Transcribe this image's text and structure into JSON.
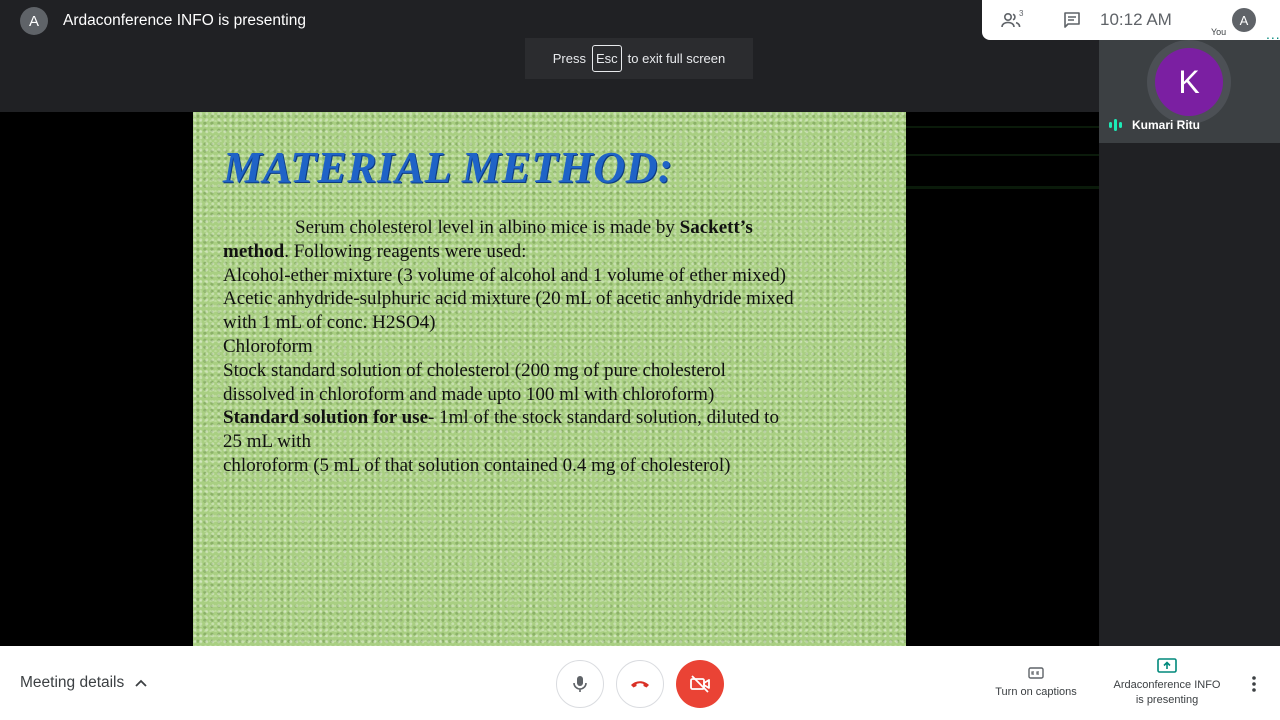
{
  "header": {
    "presenter_initial": "A",
    "presenter_text": "Ardaconference INFO is presenting"
  },
  "fullscreen_toast": {
    "prefix": "Press",
    "key": "Esc",
    "suffix": "to exit full screen"
  },
  "top_panel": {
    "participants_count": "3",
    "clock": "10:12 AM",
    "self_initial": "A",
    "self_label": "You",
    "more_dots": "..."
  },
  "slide": {
    "title": "MATERIAL METHOD:",
    "line1_pre": "Serum cholesterol level in albino mice is made by ",
    "line1_bold": "Sackett’s",
    "line2_bold": "method",
    "line2_rest": ". Following reagents were used:",
    "line3": "Alcohol-ether mixture (3 volume of alcohol and 1 volume of ether mixed)",
    "line4": "Acetic anhydride-sulphuric acid mixture (20 mL of acetic anhydride mixed",
    "line5": "with 1 mL of conc. H2SO4)",
    "line6": "Chloroform",
    "line7": "Stock standard solution of cholesterol (200 mg of pure cholesterol",
    "line8": "dissolved in chloroform and made upto 100 ml with chloroform)",
    "line9_bold": "Standard solution for use",
    "line9_rest": "- 1ml of the stock standard solution, diluted to",
    "line10": "25 mL with",
    "line11": "chloroform (5 mL of that solution contained 0.4 mg of cholesterol)"
  },
  "participant": {
    "initial": "K",
    "name": "Kumari Ritu"
  },
  "bottom_bar": {
    "meeting_details": "Meeting details",
    "captions": "Turn on captions",
    "presenting_line1": "Ardaconference INFO",
    "presenting_line2": "is presenting"
  },
  "colors": {
    "end_call_red": "#ea4335",
    "participant_avatar": "#7b1fa2",
    "audio_indicator": "#1de9b6",
    "slide_title_blue": "#1f63c7"
  }
}
